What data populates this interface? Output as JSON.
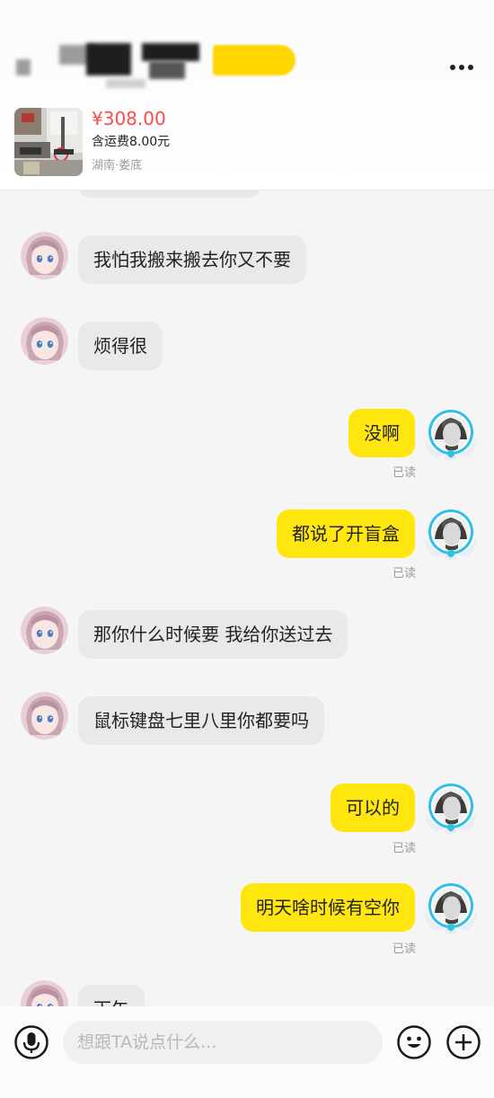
{
  "header": {
    "product": {
      "price": "¥308.00",
      "shipping": "含运费8.00元",
      "location": "湖南·娄底"
    }
  },
  "messages": [
    {
      "side": "in",
      "text": "我怕我搬来搬去你又不要"
    },
    {
      "side": "in",
      "text": "烦得很"
    },
    {
      "side": "out",
      "text": "没啊",
      "status": "已读"
    },
    {
      "side": "out",
      "text": "都说了开盲盒",
      "status": "已读"
    },
    {
      "side": "in",
      "text": "那你什么时候要 我给你送过去"
    },
    {
      "side": "in",
      "text": "鼠标键盘七里八里你都要吗"
    },
    {
      "side": "out",
      "text": "可以的",
      "status": "已读"
    },
    {
      "side": "out",
      "text": "明天啥时候有空你",
      "status": "已读"
    },
    {
      "side": "in",
      "text": "下午"
    }
  ],
  "input": {
    "placeholder": "想跟TA说点什么..."
  },
  "icons": {
    "voice": "microphone-icon",
    "emoji": "emoji-icon",
    "add": "plus-icon",
    "more": "more-icon"
  },
  "colors": {
    "outgoing_bubble": "#ffe60f",
    "incoming_bubble": "#e9e9eb",
    "price": "#ff4a4a"
  }
}
